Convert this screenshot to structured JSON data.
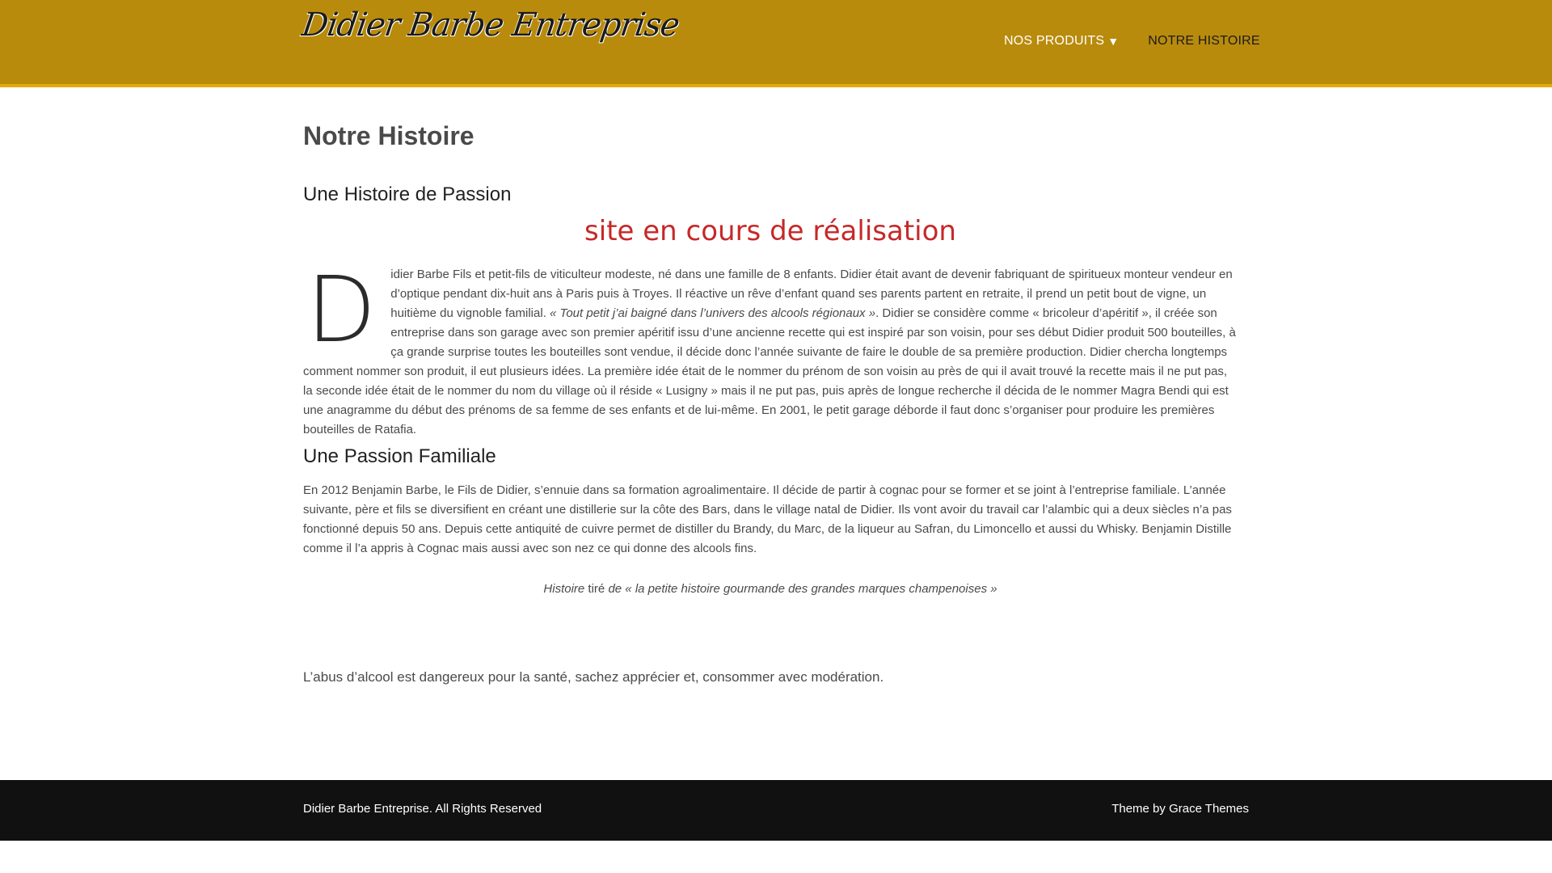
{
  "header": {
    "logo": "Didier Barbe Entreprise",
    "nav": {
      "products": "NOS PRODUITS",
      "products_arrow": "▼",
      "histoire": "NOTRE HISTOIRE"
    }
  },
  "main": {
    "page_title": "Notre Histoire",
    "section1_title": "Une Histoire de Passion",
    "notice": "site en cours de réalisation",
    "dropcap": "D",
    "para1_a": "idier Barbe Fils et petit-fils de viticulteur modeste, né dans une famille de 8 enfants. Didier était avant de devenir fabriquant de spiritueux monteur vendeur en d’optique pendant dix-huit ans à Paris puis à Troyes. Il réactive un rêve d’enfant quand ses parents partent en retraite, il prend un petit bout de vigne, un huitième du vignoble familial. ",
    "para1_quote": "« Tout petit j’ai baigné dans l’univers des alcools régionaux »",
    "para1_b": ". Didier se considère comme « bricoleur d’apéritif », il créée son entreprise dans son garage avec son premier apéritif issu d’une ancienne recette qui est inspiré par son voisin, pour ses début Didier produit 500 bouteilles, à ça grande surprise toutes les bouteilles sont vendue, il décide donc l’année suivante de faire le double de sa première production. Didier chercha longtemps comment nommer son produit, il eut plusieurs idées. La première idée était de le nommer du prénom de son voisin au près de qui il avait trouvé la recette mais il ne put pas, la seconde idée était de le nommer du nom du village où il réside « Lusigny » mais il ne put pas, puis après de longue recherche il décida de le nommer Magra Bendi qui est une anagramme du début des prénoms de sa femme de ses enfants et de lui-même. En 2001, le petit garage déborde il faut donc s’organiser pour produire les premières bouteilles de Ratafia.",
    "section2_title": "Une Passion Familiale",
    "para2": "En 2012 Benjamin Barbe, le Fils de Didier, s’ennuie dans sa formation agroalimentaire. Il décide de partir à cognac pour se former et se joint à l’entreprise familiale. L’année suivante, père et fils se diversifient en créant une distillerie sur la côte des Bars, dans le village natal de Didier. Ils vont avoir du travail car l’alambic qui a deux siècles n’a pas fonctionné depuis 50 ans. Depuis cette antiquité de cuivre permet de distiller du Brandy, du Marc, de la liqueur au Safran, du Limoncello et aussi du Whisky. Benjamin Distille comme il l’a appris à Cognac mais aussi avec son nez ce qui donne des alcools fins.",
    "citation_a": "Histoire",
    "citation_b": " tiré ",
    "citation_c": "de « la petite histoire gourmande des grandes marques champenoises »",
    "warning": "L’abus d’alcool est dangereux pour la santé, sachez apprécier et, consommer avec modération."
  },
  "footer": {
    "copyright": "Didier Barbe Entreprise. All Rights Reserved",
    "theme_prefix": "Theme by ",
    "theme_link": "Grace Themes"
  },
  "colors": {
    "header_bg": "#b98b0c",
    "header_border": "#e8a80b",
    "notice": "#c62828",
    "footer_bg": "#111111"
  }
}
